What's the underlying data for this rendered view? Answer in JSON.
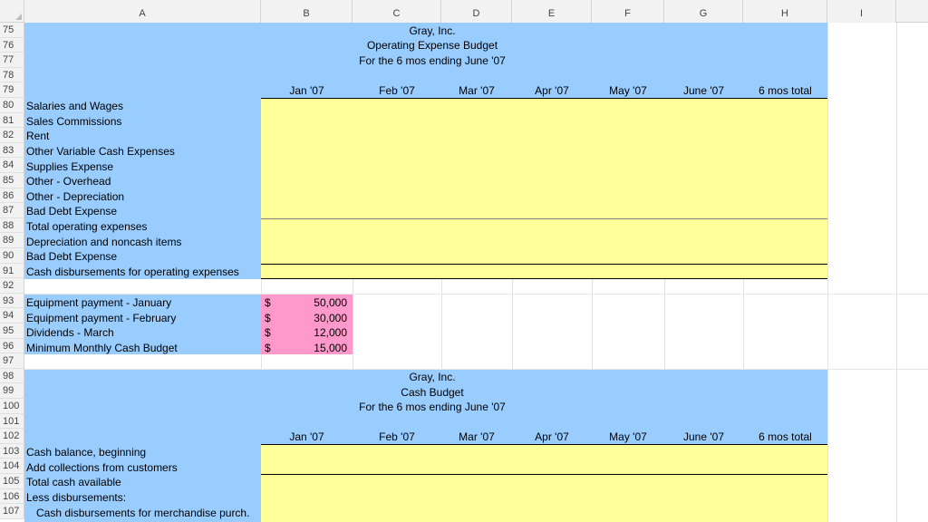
{
  "columns": [
    "A",
    "B",
    "C",
    "D",
    "E",
    "F",
    "G",
    "H",
    "I"
  ],
  "rows": [
    "75",
    "76",
    "77",
    "78",
    "79",
    "80",
    "81",
    "82",
    "83",
    "84",
    "85",
    "86",
    "87",
    "88",
    "89",
    "90",
    "91",
    "92",
    "93",
    "94",
    "95",
    "96",
    "97",
    "98",
    "99",
    "100",
    "101",
    "102",
    "103",
    "104",
    "105",
    "106",
    "107"
  ],
  "budget1": {
    "company": "Gray, Inc.",
    "title": "Operating Expense Budget",
    "period": "For the 6 mos ending June '07",
    "months": [
      "Jan '07",
      "Feb '07",
      "Mar '07",
      "Apr '07",
      "May '07",
      "June '07",
      "6 mos total"
    ],
    "items": [
      "Salaries and Wages",
      "Sales Commissions",
      "Rent",
      "Other Variable Cash Expenses",
      "Supplies Expense",
      "Other - Overhead",
      "Other - Depreciation",
      "Bad Debt Expense",
      "Total operating expenses",
      "Depreciation and noncash items",
      "Bad Debt Expense",
      "Cash disbursements for operating expenses"
    ]
  },
  "payments": {
    "items": [
      "Equipment payment - January",
      "Equipment payment - February",
      "Dividends - March",
      "Minimum Monthly Cash Budget"
    ],
    "currency": [
      "$",
      "$",
      "$",
      "$"
    ],
    "values": [
      "50,000",
      "30,000",
      "12,000",
      "15,000"
    ]
  },
  "budget2": {
    "company": "Gray, Inc.",
    "title": "Cash Budget",
    "period": "For the 6 mos ending June '07",
    "months": [
      "Jan '07",
      "Feb '07",
      "Mar '07",
      "Apr '07",
      "May '07",
      "June '07",
      "6 mos total"
    ],
    "items": [
      "Cash balance, beginning",
      "Add collections from customers",
      "Total cash available",
      "Less disbursements:",
      "Cash disbursements for merchandise purch."
    ]
  },
  "colors": {
    "label_fill": "#99ccff",
    "input_fill": "#ffff99",
    "given_fill": "#ff99cc"
  }
}
